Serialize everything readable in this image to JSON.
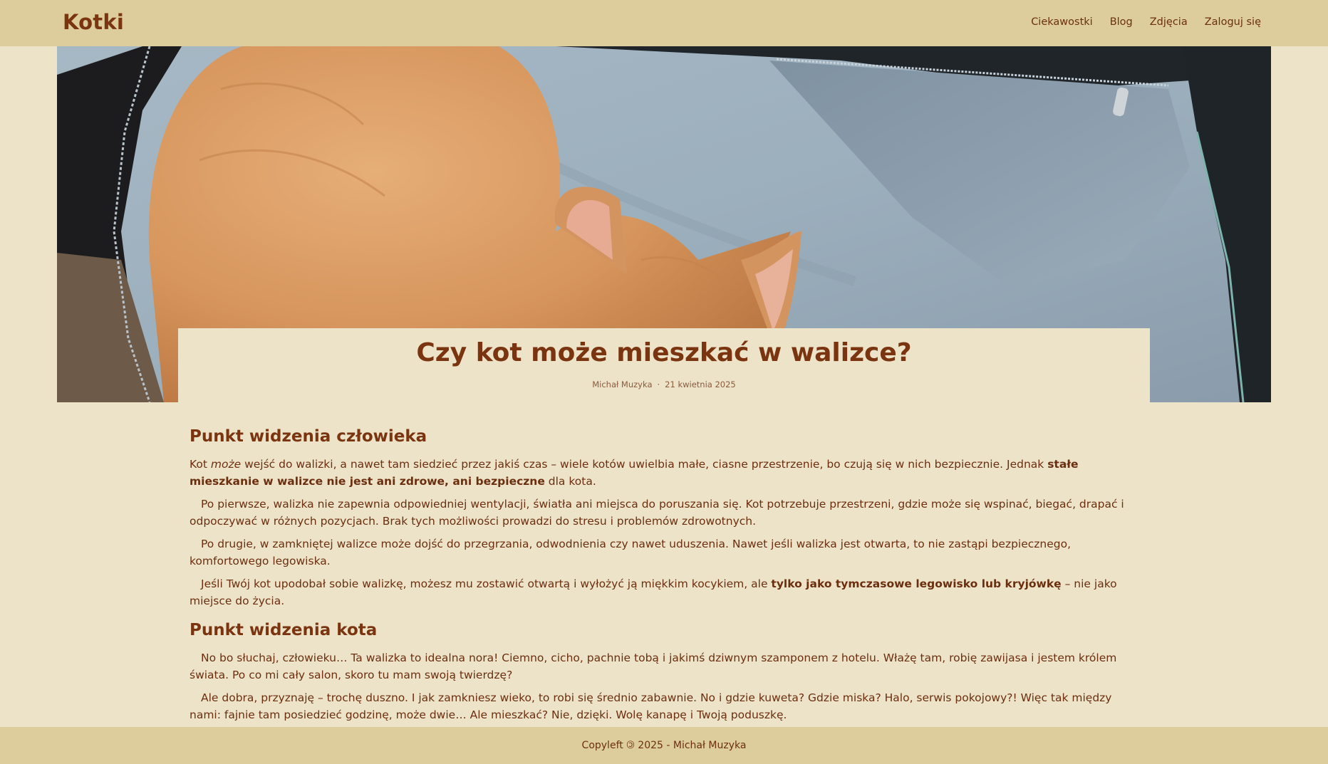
{
  "header": {
    "logo": "Kotki",
    "nav": [
      "Ciekawostki",
      "Blog",
      "Zdjęcia",
      "Zaloguj się"
    ]
  },
  "article": {
    "title": "Czy kot może mieszkać w walizce?",
    "author": "Michał Muzyka",
    "separator": "·",
    "date": "21 kwietnia 2025",
    "section1": {
      "heading": "Punkt widzenia człowieka",
      "p1_a": "Kot ",
      "p1_em": "może",
      "p1_b": " wejść do walizki, a nawet tam siedzieć przez jakiś czas – wiele kotów uwielbia małe, ciasne przestrzenie, bo czują się w nich bezpiecznie. Jednak ",
      "p1_strong": "stałe mieszkanie w walizce nie jest ani zdrowe, ani bezpieczne",
      "p1_c": " dla kota.",
      "p2": "Po pierwsze, walizka nie zapewnia odpowiedniej wentylacji, światła ani miejsca do poruszania się. Kot potrzebuje przestrzeni, gdzie może się wspinać, biegać, drapać i odpoczywać w różnych pozycjach. Brak tych możliwości prowadzi do stresu i problemów zdrowotnych.",
      "p3": "Po drugie, w zamkniętej walizce może dojść do przegrzania, odwodnienia czy nawet uduszenia. Nawet jeśli walizka jest otwarta, to nie zastąpi bezpiecznego, komfortowego legowiska.",
      "p4_a": "Jeśli Twój kot upodobał sobie walizkę, możesz mu zostawić otwartą i wyłożyć ją miękkim kocykiem, ale ",
      "p4_strong": "tylko jako tymczasowe legowisko lub kryjówkę",
      "p4_b": " – nie jako miejsce do życia."
    },
    "section2": {
      "heading": "Punkt widzenia kota",
      "p1": "No bo słuchaj, człowieku… Ta walizka to idealna nora! Ciemno, cicho, pachnie tobą i jakimś dziwnym szamponem z hotelu. Włażę tam, robię zawijasa i jestem królem świata. Po co mi cały salon, skoro tu mam swoją twierdzę?",
      "p2": "Ale dobra, przyznaję – trochę duszno. I jak zamkniesz wieko, to robi się średnio zabawnie. No i gdzie kuweta? Gdzie miska? Halo, serwis pokojowy?! Więc tak między nami: fajnie tam posiedzieć godzinę, może dwie… Ale mieszkać? Nie, dzięki. Wolę kanapę i Twoją poduszkę."
    }
  },
  "footer": {
    "text": "Copyleft 🄯 2025 - Michał Muzyka"
  }
}
